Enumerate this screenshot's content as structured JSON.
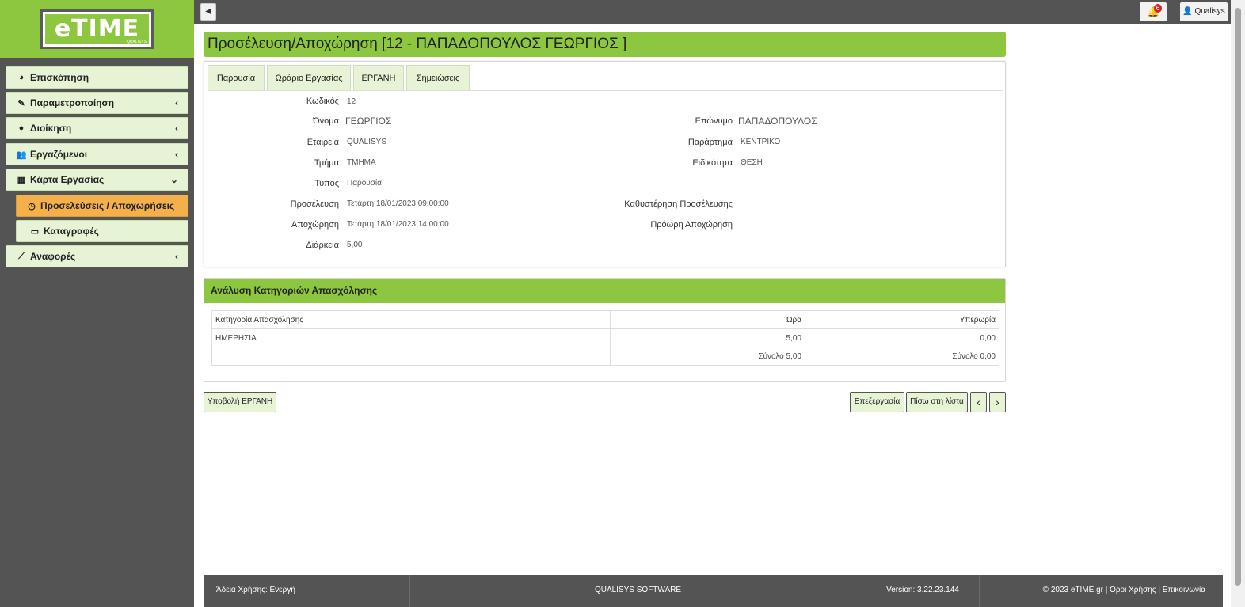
{
  "sidebar": {
    "logo_text": "eTIME",
    "logo_sub": "QUALISYS",
    "items": [
      {
        "label": "Επισκόπηση",
        "icon": "pie-chart-icon"
      },
      {
        "label": "Παραμετροποίηση",
        "icon": "wrench-icon"
      },
      {
        "label": "Διοίκηση",
        "icon": "globe-icon"
      },
      {
        "label": "Εργαζόμενοι",
        "icon": "users-icon"
      },
      {
        "label": "Κάρτα Εργασίας",
        "icon": "calendar-icon"
      },
      {
        "label": "Προσελεύσεις / Αποχωρήσεις",
        "icon": "clock-icon"
      },
      {
        "label": "Καταγραφές",
        "icon": "card-icon"
      },
      {
        "label": "Αναφορές",
        "icon": "line-chart-icon"
      }
    ]
  },
  "topbar": {
    "notifications_count": "6",
    "user_label": "Qualisys"
  },
  "page": {
    "title": "Προσέλευση/Αποχώρηση [12 - ΠΑΠΑΔΟΠΟΥΛΟΣ ΓΕΩΡΓΙΟΣ ]"
  },
  "tabs": [
    "Παρουσία",
    "Ωράριο Εργασίας",
    "ΕΡΓΑΝΗ",
    "Σημειώσεις"
  ],
  "details": {
    "code_label": "Κωδικός",
    "code": "12",
    "name_label": "Όνομα",
    "name": "ΓΕΩΡΓΙΟΣ",
    "surname_label": "Επώνυμο",
    "surname": "ΠΑΠΑΔΟΠΟΥΛΟΣ",
    "company_label": "Εταιρεία",
    "company": "QUALISYS",
    "branch_label": "Παράρτημα",
    "branch": "ΚΕΝΤΡΙΚΟ",
    "department_label": "Τμήμα",
    "department": "ΤΜΗΜΑ",
    "specialty_label": "Ειδικότητα",
    "specialty": "ΘΕΣΗ",
    "type_label": "Τύπος",
    "type": "Παρουσία",
    "arrival_label": "Προσέλευση",
    "arrival": "Τετάρτη 18/01/2023 09:00:00",
    "late_label": "Καθυστέρηση Προσέλευσης",
    "departure_label": "Αποχώρηση",
    "departure": "Τετάρτη 18/01/2023 14:00:00",
    "early_label": "Πρόωρη Αποχώρηση",
    "duration_label": "Διάρκεια",
    "duration": "5,00"
  },
  "breakdown": {
    "title": "Ανάλυση Κατηγοριών Απασχόλησης",
    "headers": [
      "Κατηγορία Απασχόλησης",
      "Ώρα",
      "Υπερωρία"
    ],
    "rows": [
      [
        "ΗΜΕΡΗΣΙΑ",
        "5,00",
        "0,00"
      ]
    ],
    "totals": [
      "",
      "Σύνολο 5,00",
      "Σύνολο 0,00"
    ]
  },
  "buttons": {
    "submit_ergani": "Υποβολή ΕΡΓΑΝΗ",
    "edit": "Επεξεργασία",
    "back_to_list": "Πίσω στη λίστα",
    "prev": "‹",
    "next": "›"
  },
  "footer": {
    "license": "Άδεια Χρήσης: Ενεργή",
    "company": "QUALISYS SOFTWARE",
    "version": "Version: 3.22.23.144",
    "copyright": "© 2023 eTIME.gr | Όροι Χρήσης | Επικοινωνία"
  },
  "colors": {
    "accent_green": "#8dc63f",
    "light_green": "#e6f3d5",
    "active_orange": "#f4b04a",
    "dark_gray": "#545454",
    "badge_red": "#d9232d"
  }
}
